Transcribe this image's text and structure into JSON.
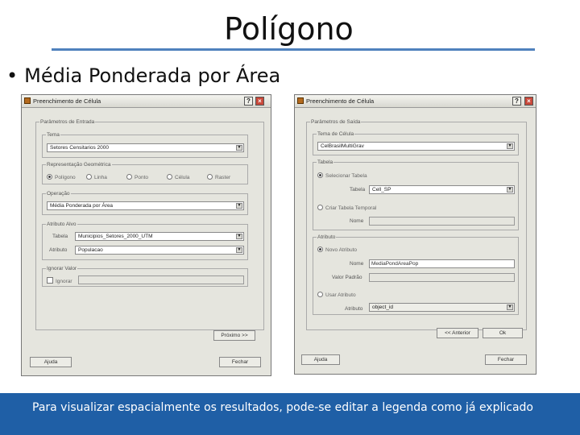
{
  "slide": {
    "title": "Polígono",
    "bullet": "Média Ponderada por Área",
    "caption": "Para visualizar espacialmente os resultados, pode-se editar a legenda como já explicado"
  },
  "left_window": {
    "title": "Preenchimento de Célula",
    "help": "?",
    "close": "×",
    "params_group": "Parâmetros de Entrada",
    "tema_group": "Tema",
    "tema_value": "Setores Censitarios 2000",
    "rep_group": "Representação Geométrica",
    "rep_options": [
      "Polígono",
      "Linha",
      "Ponto",
      "Célula",
      "Raster"
    ],
    "operacao_group": "Operação",
    "operacao_value": "Média Ponderada por Área",
    "atributos_group": "Atributo Alvo",
    "tabela_label": "Tabela",
    "tabela_value": "Municipios_Setores_2000_UTM",
    "atributo_label": "Atributo",
    "atributo_value": "Populacao",
    "ignorar_group": "Ignorar Valor",
    "ignorar_label": "Ignorar",
    "ajuda_button": "Ajuda",
    "proximo_button": "Próximo >>",
    "fechar_button": "Fechar"
  },
  "right_window": {
    "title": "Preenchimento de Célula",
    "help": "?",
    "close": "×",
    "params_group": "Parâmetros de Saída",
    "tema_group": "Tema de Célula",
    "tema_value": "CelBrasilMultiGrav",
    "tabela_group": "Tabela",
    "selecionar_tabela": "Selecionar Tabela",
    "tabela_label": "Tabela",
    "tabela_value": "Cell_SP",
    "criar_tabela": "Criar Tabela Temporal",
    "nome_label": "Nome",
    "atributo_group": "Atributo",
    "novo_atributo": "Novo Atributo",
    "nome_attr_label": "Nome",
    "nome_attr_value": "MediaPondAreaPop",
    "valor_default_label": "Valor Padrão",
    "usar_atributo": "Usar Atributo",
    "atributo_label": "Atributo",
    "atributo_value": "object_id",
    "anterior_button": "<< Anterior",
    "ok_button": "Ok",
    "ajuda_button": "Ajuda",
    "fechar_button": "Fechar"
  }
}
